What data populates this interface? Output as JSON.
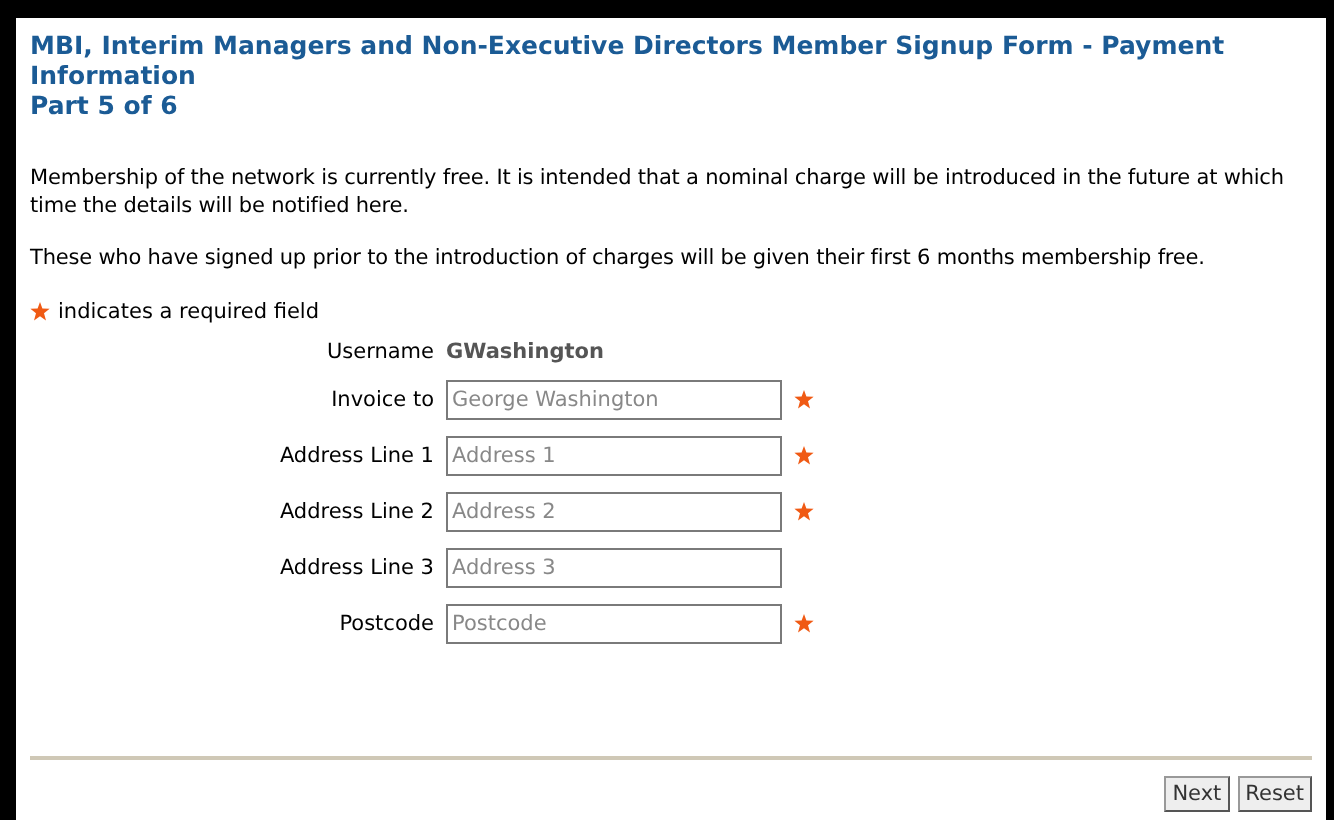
{
  "heading": {
    "title": "MBI, Interim Managers and Non-Executive Directors Member Signup Form - Payment Information",
    "subtitle": "Part 5 of 6"
  },
  "paragraphs": [
    "Membership of the network is currently free. It is intended that a nominal charge will be introduced in the future at which time the details will be notified here.",
    "These who have signed up prior to the introduction of charges will be given their first 6 months membership free."
  ],
  "required_note": "indicates a required field",
  "username": {
    "label": "Username",
    "value": "GWashington"
  },
  "fields": [
    {
      "label": "Invoice to",
      "placeholder": "George Washington",
      "required": true
    },
    {
      "label": "Address Line 1",
      "placeholder": "Address 1",
      "required": true
    },
    {
      "label": "Address Line 2",
      "placeholder": "Address 2",
      "required": true
    },
    {
      "label": "Address Line 3",
      "placeholder": "Address 3",
      "required": false
    },
    {
      "label": "Postcode",
      "placeholder": "Postcode",
      "required": true
    }
  ],
  "buttons": [
    "Next",
    "Reset"
  ]
}
